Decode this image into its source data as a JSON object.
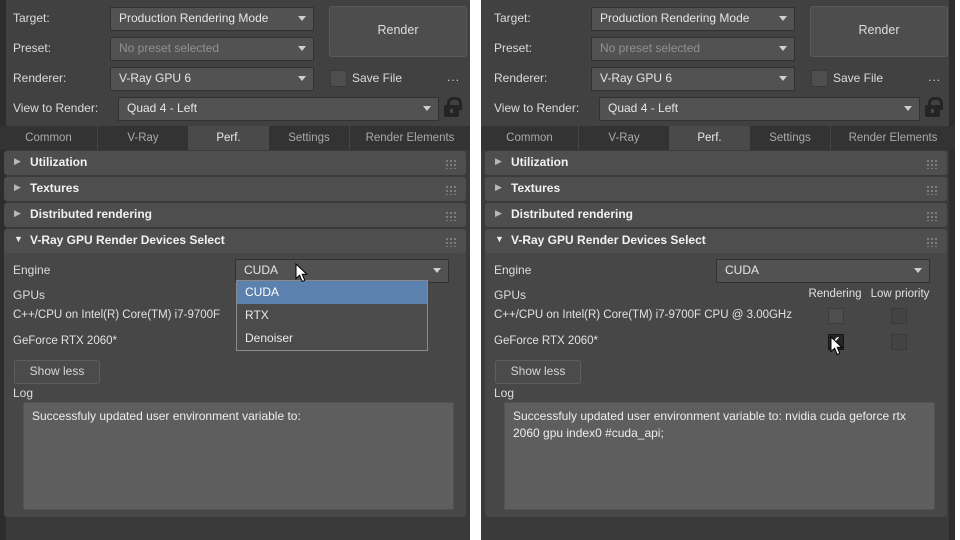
{
  "colors": {
    "panel_bg": "#414141",
    "selection_blue": "#5d81ae",
    "rollout_header": "#4e4e4e",
    "log_bg": "#5e5e5e"
  },
  "panels": {
    "left": {
      "target_label": "Target:",
      "target_value": "Production Rendering Mode",
      "preset_label": "Preset:",
      "preset_value": "No preset selected",
      "renderer_label": "Renderer:",
      "renderer_value": "V-Ray GPU 6",
      "render_button": "Render",
      "save_file_label": "Save File",
      "more_button": "...",
      "view_label": "View to Render:",
      "view_value": "Quad 4 - Left",
      "tabs": {
        "common": "Common",
        "vray": "V-Ray",
        "perf": "Perf.",
        "settings": "Settings",
        "render_elements": "Render Elements",
        "active": "Perf."
      },
      "rollouts": {
        "utilization": "Utilization",
        "textures": "Textures",
        "distributed": "Distributed rendering",
        "devices": "V-Ray GPU Render Devices Select"
      },
      "engine_label": "Engine",
      "engine_value": "CUDA",
      "engine_dropdown": {
        "open": true,
        "selected": "CUDA",
        "options": [
          "CUDA",
          "RTX",
          "Denoiser"
        ]
      },
      "gpus_label": "GPUs",
      "cpu_device": "C++/CPU on Intel(R) Core(TM) i7-9700F",
      "gpu_device": "GeForce RTX 2060*",
      "show_less": "Show less",
      "log_label": "Log",
      "log_text": "Successfuly updated user environment variable to:"
    },
    "right": {
      "target_label": "Target:",
      "target_value": "Production Rendering Mode",
      "preset_label": "Preset:",
      "preset_value": "No preset selected",
      "renderer_label": "Renderer:",
      "renderer_value": "V-Ray GPU 6",
      "render_button": "Render",
      "save_file_label": "Save File",
      "more_button": "...",
      "view_label": "View to Render:",
      "view_value": "Quad 4 - Left",
      "tabs": {
        "common": "Common",
        "vray": "V-Ray",
        "perf": "Perf.",
        "settings": "Settings",
        "render_elements": "Render Elements",
        "active": "Perf."
      },
      "rollouts": {
        "utilization": "Utilization",
        "textures": "Textures",
        "distributed": "Distributed rendering",
        "devices": "V-Ray GPU Render Devices Select"
      },
      "engine_label": "Engine",
      "engine_value": "CUDA",
      "engine_dropdown": {
        "open": false,
        "selected": "CUDA"
      },
      "gpus_label": "GPUs",
      "gpu_columns": {
        "rendering": "Rendering",
        "low_priority": "Low priority"
      },
      "cpu_device": "C++/CPU on Intel(R) Core(TM) i7-9700F CPU @ 3.00GHz",
      "gpu_device": "GeForce RTX 2060*",
      "checkboxes": {
        "cpu_rendering": false,
        "cpu_low_priority": false,
        "gpu_rendering": true,
        "gpu_low_priority": false
      },
      "show_less": "Show less",
      "log_label": "Log",
      "log_text": "Successfuly updated user environment variable to: nvidia cuda geforce rtx 2060 gpu index0 #cuda_api;"
    }
  }
}
